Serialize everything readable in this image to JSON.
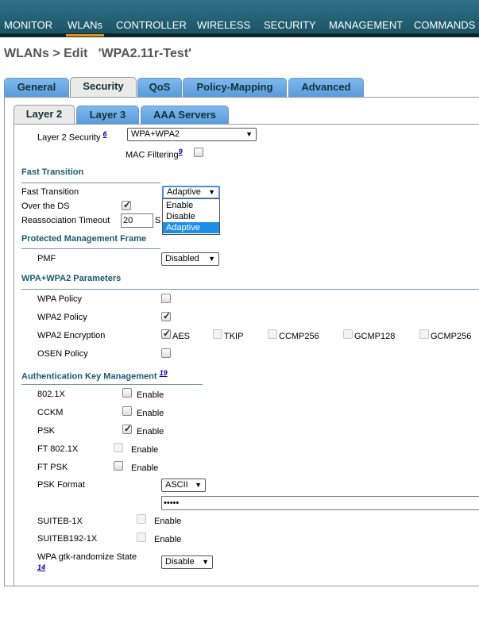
{
  "nav": {
    "items": [
      {
        "label": "MONITOR",
        "access_key": "M"
      },
      {
        "label": "WLANs",
        "access_key": "W"
      },
      {
        "label": "CONTROLLER",
        "access_key": "C"
      },
      {
        "label": "WIRELESS",
        "access_key": "I"
      },
      {
        "label": "SECURITY",
        "access_key": "S"
      },
      {
        "label": "MANAGEMENT",
        "access_key": "A"
      },
      {
        "label": "COMMANDS",
        "access_key": "O"
      }
    ],
    "active": "WLANs"
  },
  "page_title": "WLANs > Edit   'WPA2.11r-Test'",
  "tabs": [
    "General",
    "Security",
    "QoS",
    "Policy-Mapping",
    "Advanced"
  ],
  "subtabs": [
    "Layer 2",
    "Layer 3",
    "AAA Servers"
  ],
  "layer2": {
    "security_label": "Layer 2 Security",
    "security_ref": "6",
    "security_value": "WPA+WPA2",
    "mac_filtering_label": "MAC Filtering",
    "mac_filtering_ref": "9"
  },
  "fast_transition": {
    "section_title": "Fast Transition",
    "ft_label": "Fast Transition",
    "ft_value": "Adaptive",
    "options": [
      "Enable",
      "Disable",
      "Adaptive"
    ],
    "over_ds_label": "Over the DS",
    "reassoc_label": "Reassociation Timeout",
    "reassoc_value": "20",
    "reassoc_unit_partial": "S"
  },
  "pmf": {
    "section_title": "Protected Management Frame",
    "label": "PMF",
    "value": "Disabled"
  },
  "wpa": {
    "section_title": "WPA+WPA2 Parameters",
    "wpa_policy_label": "WPA Policy",
    "wpa2_policy_label": "WPA2 Policy",
    "wpa2_encryption_label": "WPA2 Encryption",
    "ciphers": [
      "AES",
      "TKIP",
      "CCMP256",
      "GCMP128",
      "GCMP256"
    ],
    "osen_label": "OSEN Policy"
  },
  "akm": {
    "section_title": "Authentication Key Management",
    "section_ref": "19",
    "enable_text": "Enable",
    "rows": [
      "802.1X",
      "CCKM",
      "PSK",
      "FT 802.1X",
      "FT PSK"
    ],
    "psk_format_label": "PSK Format",
    "psk_format_value": "ASCII",
    "psk_value": "•••••",
    "suiteb_label": "SUITEB-1X",
    "suiteb192_label": "SUITEB192-1X",
    "gtk_label": "WPA gtk-randomize State",
    "gtk_ref": "14",
    "gtk_value": "Disable"
  },
  "state": {
    "mac_filtering": false,
    "over_ds": true,
    "wpa_policy": false,
    "wpa2_policy": true,
    "aes": true,
    "tkip": false,
    "ccmp256": false,
    "gcmp128": false,
    "gcmp256": false,
    "osen": false,
    "akm_8021x": false,
    "cckm": false,
    "psk": true,
    "ft_8021x": false,
    "ft_psk": false,
    "suiteb_1x": false,
    "suiteb192_1x": false
  },
  "colors": {
    "nav_bg": "#1d5466",
    "nav_active_underline": "#e8900f",
    "tab_bg": "#6aa8e4",
    "section_text": "#1c5a70",
    "dropdown_highlight": "#1e8ee8"
  }
}
